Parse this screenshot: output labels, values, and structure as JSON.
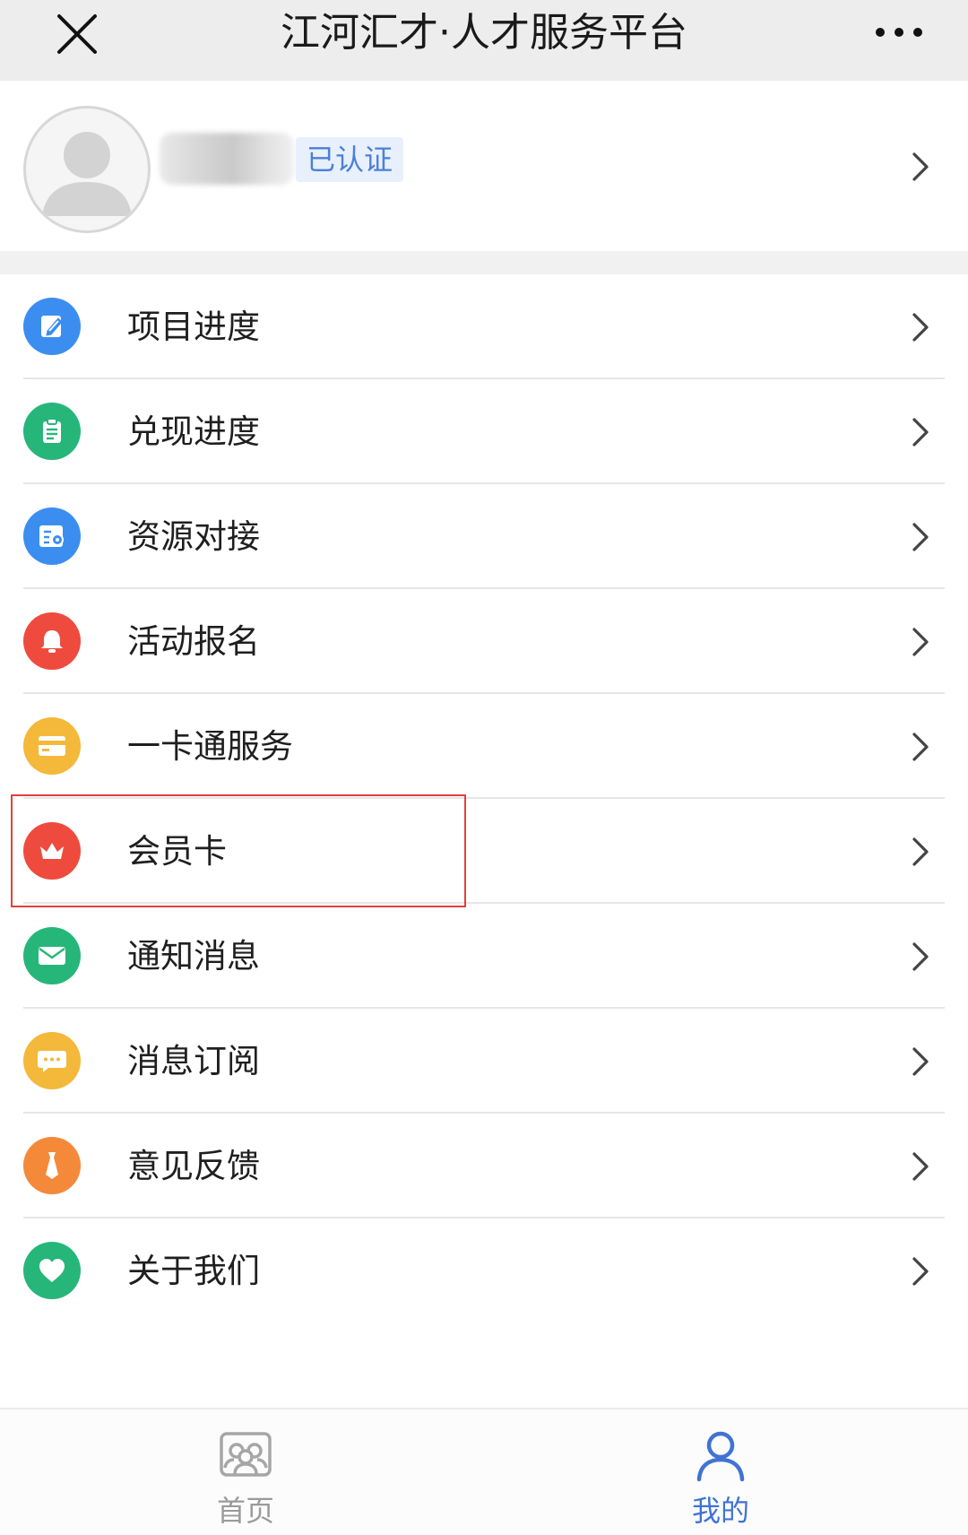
{
  "header": {
    "title": "江河汇才·人才服务平台"
  },
  "profile": {
    "badge": "已认证"
  },
  "menu": {
    "items": [
      {
        "label": "项目进度",
        "icon": "edit-icon",
        "color": "#3b8ef0"
      },
      {
        "label": "兑现进度",
        "icon": "clipboard-icon",
        "color": "#27b67a"
      },
      {
        "label": "资源对接",
        "icon": "document-icon",
        "color": "#3b8ef0"
      },
      {
        "label": "活动报名",
        "icon": "bell-icon",
        "color": "#ee4b3e"
      },
      {
        "label": "一卡通服务",
        "icon": "card-icon",
        "color": "#f4b83a"
      },
      {
        "label": "会员卡",
        "icon": "crown-icon",
        "color": "#ee4b3e"
      },
      {
        "label": "通知消息",
        "icon": "mail-icon",
        "color": "#27b67a"
      },
      {
        "label": "消息订阅",
        "icon": "chat-icon",
        "color": "#f4b83a"
      },
      {
        "label": "意见反馈",
        "icon": "tie-icon",
        "color": "#f5893a"
      },
      {
        "label": "关于我们",
        "icon": "heart-icon",
        "color": "#27b67a"
      }
    ]
  },
  "tabbar": {
    "home_label": "首页",
    "mine_label": "我的",
    "active": "mine"
  },
  "colors": {
    "accent": "#3f73d4",
    "highlight": "#e0403f"
  }
}
